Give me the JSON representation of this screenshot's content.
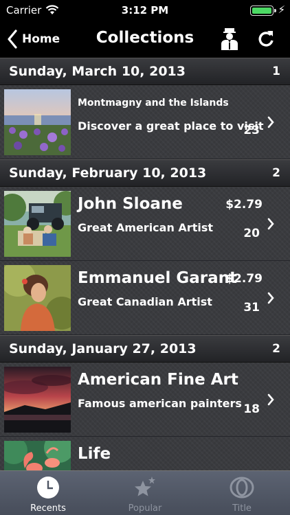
{
  "status_bar": {
    "carrier": "Carrier",
    "time": "3:12 PM"
  },
  "nav": {
    "back_label": "Home",
    "title": "Collections"
  },
  "sections": [
    {
      "date": "Sunday, March 10, 2013",
      "count": "1",
      "items": [
        {
          "title": "Montmagny and the Islands",
          "subtitle": "Discover a great place to visit",
          "price": "",
          "count": "23"
        }
      ]
    },
    {
      "date": "Sunday, February 10, 2013",
      "count": "2",
      "items": [
        {
          "title": "John Sloane",
          "subtitle": "Great American Artist",
          "price": "$2.79",
          "count": "20"
        },
        {
          "title": "Emmanuel Garant",
          "subtitle": "Great Canadian Artist",
          "price": "$2.79",
          "count": "31"
        }
      ]
    },
    {
      "date": "Sunday, January 27, 2013",
      "count": "2",
      "items": [
        {
          "title": "American Fine Art",
          "subtitle": "Famous american painters",
          "price": "",
          "count": "18"
        },
        {
          "title": "Life",
          "subtitle": "",
          "price": "",
          "count": ""
        }
      ]
    }
  ],
  "tabs": [
    {
      "label": "Recents",
      "icon": "clock-icon",
      "active": true
    },
    {
      "label": "Popular",
      "icon": "star-icon",
      "active": false
    },
    {
      "label": "Title",
      "icon": "eye-icon",
      "active": false
    }
  ],
  "colors": {
    "battery": "#4cd964",
    "background": "#3a3b3f",
    "tab_active": "#ffffff",
    "tab_inactive": "#8e94a0"
  }
}
